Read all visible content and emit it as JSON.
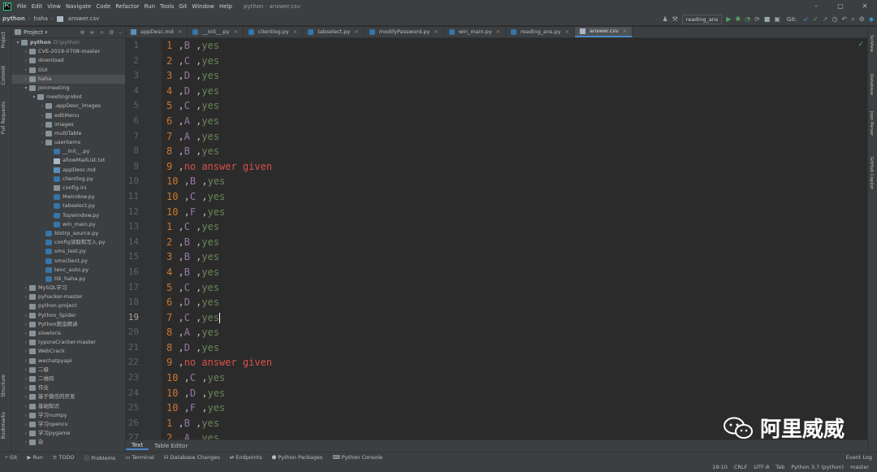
{
  "menubar": {
    "items": [
      "File",
      "Edit",
      "View",
      "Navigate",
      "Code",
      "Refactor",
      "Run",
      "Tools",
      "Git",
      "Window",
      "Help"
    ],
    "title": "python - answer.csv"
  },
  "navbar": {
    "breadcrumbs": [
      "python",
      "haha",
      "answer.csv"
    ],
    "run_config": "reading_ans",
    "git_label": "Git:"
  },
  "sidebar": {
    "left_tabs": [
      "Project",
      "Commit",
      "Pull Requests",
      "Structure",
      "Bookmarks"
    ],
    "right_tabs": [
      "SciView",
      "Database",
      "Json Parser",
      "GitHub Copilot"
    ]
  },
  "project": {
    "header": "Project",
    "tree": [
      {
        "label": "python",
        "extra": "D:\\python",
        "depth": 0,
        "type": "folder",
        "open": true,
        "bold": true
      },
      {
        "label": "CVE-2019-0708-master",
        "depth": 1,
        "type": "folder"
      },
      {
        "label": "download",
        "depth": 1,
        "type": "folder"
      },
      {
        "label": "GUI",
        "depth": 1,
        "type": "folder"
      },
      {
        "label": "haha",
        "depth": 1,
        "type": "folder",
        "selected": true
      },
      {
        "label": "joinmeeting",
        "depth": 1,
        "type": "folder",
        "open": true
      },
      {
        "label": "meetingrobot",
        "depth": 2,
        "type": "folder",
        "open": true
      },
      {
        "label": ".appDesc_images",
        "depth": 3,
        "type": "folder"
      },
      {
        "label": "editMenu",
        "depth": 3,
        "type": "folder"
      },
      {
        "label": "images",
        "depth": 3,
        "type": "folder"
      },
      {
        "label": "multiTable",
        "depth": 3,
        "type": "folder"
      },
      {
        "label": "useritems",
        "depth": 3,
        "type": "folder"
      },
      {
        "label": "__init__.py",
        "depth": 4,
        "type": "py"
      },
      {
        "label": "allowMailList.txt",
        "depth": 4,
        "type": "txt"
      },
      {
        "label": "appDesc.md",
        "depth": 4,
        "type": "md"
      },
      {
        "label": "clientlog.py",
        "depth": 4,
        "type": "py"
      },
      {
        "label": "config.ini",
        "depth": 4,
        "type": "ini"
      },
      {
        "label": "Mwindow.py",
        "depth": 4,
        "type": "py"
      },
      {
        "label": "tabselect.py",
        "depth": 4,
        "type": "py"
      },
      {
        "label": "Topwindow.py",
        "depth": 4,
        "type": "py"
      },
      {
        "label": "win_main.py",
        "depth": 4,
        "type": "py"
      },
      {
        "label": "btstrp_source.py",
        "depth": 3,
        "type": "py"
      },
      {
        "label": "config读取和写入.py",
        "depth": 3,
        "type": "py"
      },
      {
        "label": "sms_test.py",
        "depth": 3,
        "type": "py"
      },
      {
        "label": "smsclient.py",
        "depth": 3,
        "type": "py"
      },
      {
        "label": "tenc_auto.py",
        "depth": 3,
        "type": "py"
      },
      {
        "label": "ttk_haha.py",
        "depth": 3,
        "type": "py"
      },
      {
        "label": "MySQL学习",
        "depth": 1,
        "type": "folder"
      },
      {
        "label": "pyhacker-master",
        "depth": 1,
        "type": "folder"
      },
      {
        "label": "python-project",
        "depth": 1,
        "type": "folder",
        "noarrow": true
      },
      {
        "label": "Python_Spider",
        "depth": 1,
        "type": "folder"
      },
      {
        "label": "Python爬虫精讲",
        "depth": 1,
        "type": "folder"
      },
      {
        "label": "slowloris",
        "depth": 1,
        "type": "folder"
      },
      {
        "label": "typoraCracker-master",
        "depth": 1,
        "type": "folder"
      },
      {
        "label": "WebCrack",
        "depth": 1,
        "type": "folder"
      },
      {
        "label": "wechatpyapi",
        "depth": 1,
        "type": "folder"
      },
      {
        "label": "二级",
        "depth": 1,
        "type": "folder"
      },
      {
        "label": "二维码",
        "depth": 1,
        "type": "folder"
      },
      {
        "label": "作业",
        "depth": 1,
        "type": "folder"
      },
      {
        "label": "基于微信的开发",
        "depth": 1,
        "type": "folder"
      },
      {
        "label": "基础知识",
        "depth": 1,
        "type": "folder"
      },
      {
        "label": "学习numpy",
        "depth": 1,
        "type": "folder"
      },
      {
        "label": "学习opencv",
        "depth": 1,
        "type": "folder"
      },
      {
        "label": "学习pygame",
        "depth": 1,
        "type": "folder"
      },
      {
        "label": "杂",
        "depth": 1,
        "type": "folder"
      }
    ]
  },
  "editor_tabs": [
    "appDesc.md",
    "__init__.py",
    "clientlog.py",
    "tabselect.py",
    "modifyPassword.py",
    "win_main.py",
    "reading_ans.py",
    "answer.csv"
  ],
  "active_tab": 7,
  "editor": {
    "current_line": 19,
    "lines": [
      {
        "n": "1",
        "num": "1",
        "letter": "B",
        "status": "yes"
      },
      {
        "n": "2",
        "num": "2",
        "letter": "C",
        "status": "yes"
      },
      {
        "n": "3",
        "num": "3",
        "letter": "D",
        "status": "yes"
      },
      {
        "n": "4",
        "num": "4",
        "letter": "D",
        "status": "yes"
      },
      {
        "n": "5",
        "num": "5",
        "letter": "C",
        "status": "yes"
      },
      {
        "n": "6",
        "num": "6",
        "letter": "A",
        "status": "yes"
      },
      {
        "n": "7",
        "num": "7",
        "letter": "A",
        "status": "yes"
      },
      {
        "n": "8",
        "num": "8",
        "letter": "B",
        "status": "yes"
      },
      {
        "n": "9",
        "num": "9",
        "letter": "",
        "status": "no answer given"
      },
      {
        "n": "10",
        "num": "10",
        "letter": "B",
        "status": "yes"
      },
      {
        "n": "11",
        "num": "10",
        "letter": "C",
        "status": "yes"
      },
      {
        "n": "12",
        "num": "10",
        "letter": "F",
        "status": "yes"
      },
      {
        "n": "13",
        "num": "1",
        "letter": "C",
        "status": "yes"
      },
      {
        "n": "14",
        "num": "2",
        "letter": "B",
        "status": "yes"
      },
      {
        "n": "15",
        "num": "3",
        "letter": "B",
        "status": "yes"
      },
      {
        "n": "16",
        "num": "4",
        "letter": "B",
        "status": "yes"
      },
      {
        "n": "17",
        "num": "5",
        "letter": "C",
        "status": "yes"
      },
      {
        "n": "18",
        "num": "6",
        "letter": "D",
        "status": "yes"
      },
      {
        "n": "19",
        "num": "7",
        "letter": "C",
        "status": "yes"
      },
      {
        "n": "20",
        "num": "8",
        "letter": "A",
        "status": "yes"
      },
      {
        "n": "21",
        "num": "8",
        "letter": "D",
        "status": "yes"
      },
      {
        "n": "22",
        "num": "9",
        "letter": "",
        "status": "no answer given"
      },
      {
        "n": "23",
        "num": "10",
        "letter": "C",
        "status": "yes"
      },
      {
        "n": "24",
        "num": "10",
        "letter": "D",
        "status": "yes"
      },
      {
        "n": "25",
        "num": "10",
        "letter": "F",
        "status": "yes"
      },
      {
        "n": "26",
        "num": "1",
        "letter": "B",
        "status": "yes"
      },
      {
        "n": "27",
        "num": "2",
        "letter": "A",
        "status": "yes"
      }
    ]
  },
  "bottom_tabs": [
    "Text",
    "Table Editor"
  ],
  "toolwindows": [
    "Git",
    "Run",
    "TODO",
    "Problems",
    "Terminal",
    "Database Changes",
    "Endpoints",
    "Python Packages",
    "Python Console"
  ],
  "event_log": "Event Log",
  "status": [
    "19:10",
    "CRLF",
    "UTF-8",
    "Tab",
    "Python 3.7 (python)",
    "master"
  ],
  "watermark": "阿里威威",
  "colors": {
    "num": "#cc7832",
    "letter": "#9876aa",
    "status": "#6a8759",
    "error": "#d95049"
  }
}
